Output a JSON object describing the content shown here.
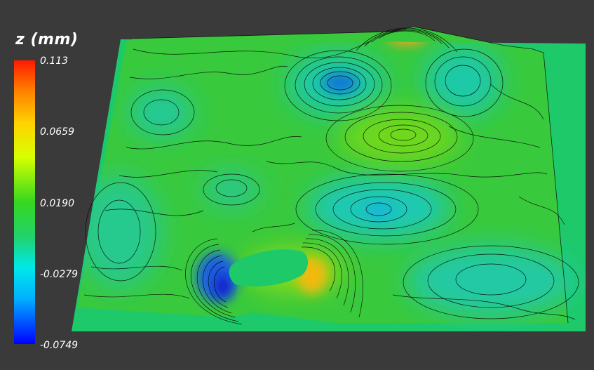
{
  "chart_data": {
    "type": "heatmap",
    "colorbar": {
      "title": "z (mm)",
      "tick_labels": [
        "0.113",
        "0.0659",
        "0.0190",
        "-0.0279",
        "-0.0749"
      ],
      "range": [
        -0.0749,
        0.113
      ],
      "colors": [
        "#ff1a00",
        "#ff7a00",
        "#ffd200",
        "#d8ff00",
        "#35d81f",
        "#22d26a",
        "#00e8e8",
        "#00b0ff",
        "#0000ff"
      ]
    },
    "background": "#3a3a3a",
    "contour_color": "#000000",
    "legend_position": "left"
  }
}
